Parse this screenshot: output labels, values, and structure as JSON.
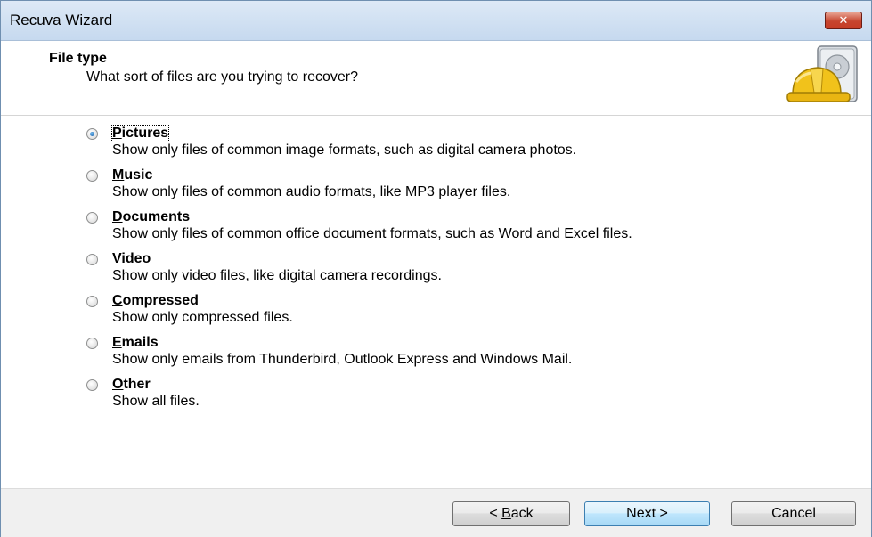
{
  "window": {
    "title": "Recuva Wizard",
    "close_label": "✕"
  },
  "header": {
    "title": "File type",
    "subtitle": "What sort of files are you trying to recover?",
    "logo_icon": "recuva-hardhat-drive-icon"
  },
  "options": [
    {
      "label_accel": "P",
      "label_rest": "ictures",
      "description": "Show only files of common image formats, such as digital camera photos.",
      "selected": true
    },
    {
      "label_accel": "M",
      "label_rest": "usic",
      "description": "Show only files of common audio formats, like MP3 player files.",
      "selected": false
    },
    {
      "label_accel": "D",
      "label_rest": "ocuments",
      "description": "Show only files of common office document formats, such as Word and Excel files.",
      "selected": false
    },
    {
      "label_accel": "V",
      "label_rest": "ideo",
      "description": "Show only video files, like digital camera recordings.",
      "selected": false
    },
    {
      "label_accel": "C",
      "label_rest": "ompressed",
      "description": "Show only compressed files.",
      "selected": false
    },
    {
      "label_accel": "E",
      "label_rest": "mails",
      "description": "Show only emails from Thunderbird, Outlook Express and Windows Mail.",
      "selected": false
    },
    {
      "label_accel": "O",
      "label_rest": "ther",
      "description": "Show all files.",
      "selected": false
    }
  ],
  "footer": {
    "back_prefix": "< ",
    "back_accel": "B",
    "back_rest": "ack",
    "next_label": "Next >",
    "cancel_label": "Cancel"
  }
}
